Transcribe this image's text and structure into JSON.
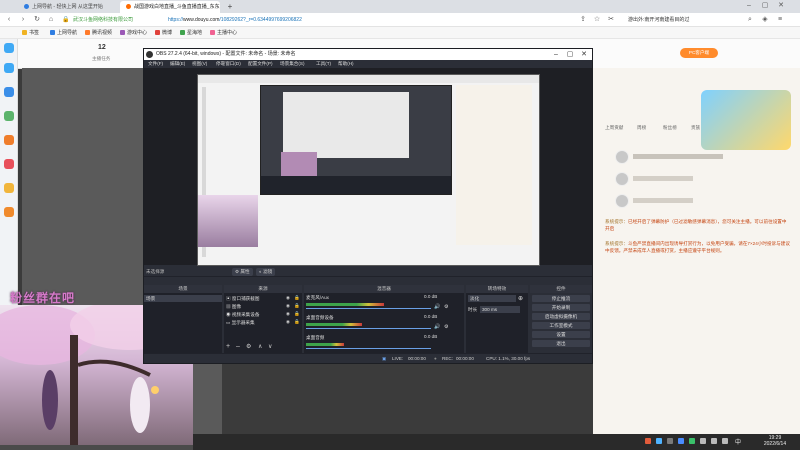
{
  "browser": {
    "tabs": [
      {
        "label": "上网导航 - 轻快上网 从这里开始",
        "active": false
      },
      {
        "label": "战国游戏白地直播_斗鱼直播直播_东东",
        "active": true
      }
    ],
    "new_tab_symbol": "+",
    "address": {
      "secure_label": "武汉斗鱼网络科技有限公司",
      "url_prefix": "https://",
      "url_host": "www.douyu.com",
      "url_rest": "/10829262?_r=0.6344997699206822"
    },
    "right_tools": "游出外:南开河南建看目的过",
    "bookmarks": [
      {
        "label": "书签",
        "color": "#f0b323"
      },
      {
        "label": "上网导航",
        "color": "#2f7de1"
      },
      {
        "label": "腾讯视频",
        "color": "#ff7a2a"
      },
      {
        "label": "游戏中心",
        "color": "#9b59b6"
      },
      {
        "label": "微博",
        "color": "#e0413b"
      },
      {
        "label": "星海地",
        "color": "#3fa34d"
      },
      {
        "label": "主播中心",
        "color": "#f06292"
      }
    ],
    "icons": [
      "back-icon",
      "forward-icon",
      "refresh-icon",
      "home-icon",
      "star-icon",
      "menu-icon"
    ]
  },
  "page": {
    "room_count": "12",
    "page_title_left": "主播任务",
    "right_panel": {
      "tabs": [
        "上周贡献",
        "周榜",
        "粉丝榜",
        "贵族"
      ],
      "pc_client_label": "PC客户端",
      "chat": [
        {
          "user": "系统提示：",
          "text": "已经开启了弹幕防护（已过滤敏感弹幕消息），您可关注主播。可以前往设置中开启"
        },
        {
          "user": "系统提示：",
          "text": "斗鱼严禁直播间内出现诱导打赏行为，以免用户受骗，请在7×24小时投诉与建议中反馈。严禁未成年人直播或打赏，主播应遵守平台规则。"
        }
      ]
    },
    "stream_overlay_text": "粉丝群在吧"
  },
  "obs": {
    "title": "OBS 27.2.4 (64-bit, windows) - 配置文件: 未命名 - 场景: 未命名",
    "menu": [
      "文件(F)",
      "编辑(E)",
      "视图(V)",
      "停靠窗口(D)",
      "配置文件(P)",
      "场景集合(S)",
      "工具(T)",
      "帮助(H)"
    ],
    "source_bar": {
      "label": "未选择源",
      "properties": "属性",
      "filters": "滤镜"
    },
    "docks": {
      "scenes": {
        "title": "场景",
        "items": [
          "场景"
        ]
      },
      "sources": {
        "title": "来源",
        "items": [
          "窗口捕获截图",
          "图像",
          "视频采集设备",
          "显示器采集"
        ]
      },
      "mixer": {
        "title": "混音器",
        "channels": [
          {
            "name": "麦克风/Aux",
            "db": "0.0 dB",
            "level": 0.62
          },
          {
            "name": "桌面音频设备",
            "db": "0.0 dB",
            "level": 0.45
          },
          {
            "name": "桌面音频",
            "db": "0.0 dB",
            "level": 0.3
          }
        ]
      },
      "transitions": {
        "title": "转场特效",
        "type": "淡化",
        "duration_label": "时长",
        "duration_value": "300 ms"
      },
      "controls": {
        "title": "控件",
        "buttons": [
          "停止推流",
          "开始录制",
          "启动虚拟摄像机",
          "工作室模式",
          "设置",
          "退出"
        ]
      }
    },
    "status": {
      "live_label": "LIVE:",
      "live_time": "00:00:00",
      "rec_label": "REC:",
      "rec_time": "00:00:00",
      "cpu": "CPU: 1.1%, 30.00 fps"
    }
  },
  "taskbar": {
    "time": "19:29",
    "date": "2022/6/14",
    "lang": "中"
  }
}
